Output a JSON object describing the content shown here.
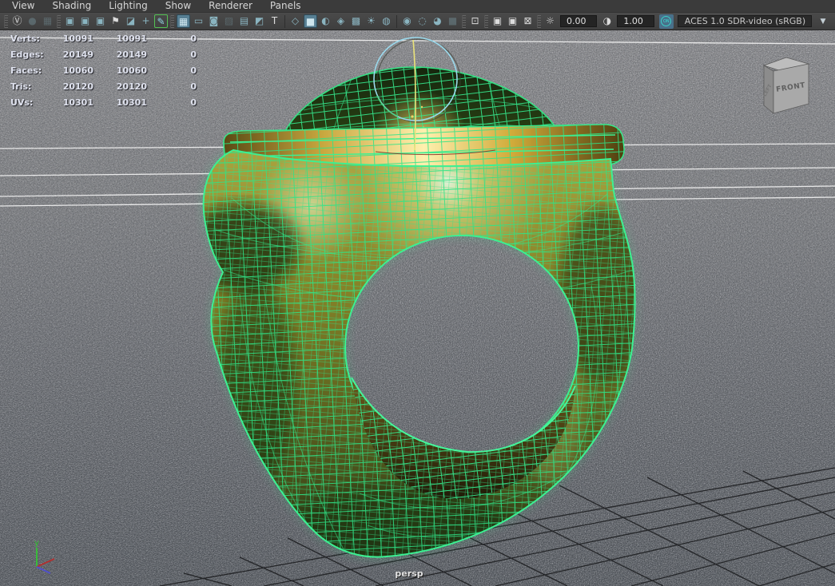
{
  "menu_bar": {
    "items": [
      "View",
      "Shading",
      "Lighting",
      "Show",
      "Renderer",
      "Panels"
    ]
  },
  "toolbar": {
    "exposure_value": "0.00",
    "gamma_value": "1.00",
    "on_badge": "ON",
    "view_transform": "ACES 1.0 SDR-video (sRGB)",
    "dropdown_arrow": "▼",
    "icons": [
      {
        "name": "viewcube-toggle",
        "glyph": "Ⓥ"
      },
      {
        "name": "disabled-tool-a",
        "glyph": "●"
      },
      {
        "name": "disabled-tool-b",
        "glyph": "▦"
      },
      {
        "name": "select-camera",
        "glyph": "▣"
      },
      {
        "name": "lock-camera",
        "glyph": "▣"
      },
      {
        "name": "camera-attributes",
        "glyph": "▣"
      },
      {
        "name": "bookmark",
        "glyph": "⚑"
      },
      {
        "name": "image-plane",
        "glyph": "◪"
      },
      {
        "name": "pan-zoom",
        "glyph": "+"
      },
      {
        "name": "grease-pencil",
        "glyph": "✎"
      },
      {
        "name": "grid",
        "glyph": "▦"
      },
      {
        "name": "film-gate",
        "glyph": "▭"
      },
      {
        "name": "resolution-gate",
        "glyph": "◙"
      },
      {
        "name": "gate-mask",
        "glyph": "▨"
      },
      {
        "name": "field-chart",
        "glyph": "▤"
      },
      {
        "name": "safe-title",
        "glyph": "◩"
      },
      {
        "name": "hud-toggle",
        "glyph": "T"
      },
      {
        "name": "wireframe-mode",
        "glyph": "◇"
      },
      {
        "name": "shaded-mode",
        "glyph": "■"
      },
      {
        "name": "wireframe-on-shaded",
        "glyph": "◐"
      },
      {
        "name": "textured-mode",
        "glyph": "◈"
      },
      {
        "name": "use-default-material",
        "glyph": "▩"
      },
      {
        "name": "lighting-mode",
        "glyph": "☀"
      },
      {
        "name": "shadows",
        "glyph": "◍"
      },
      {
        "name": "screen-space-ao",
        "glyph": "◉"
      },
      {
        "name": "motion-blur",
        "glyph": "◌"
      },
      {
        "name": "exposure-toggle",
        "glyph": "◕"
      },
      {
        "name": "depth-of-field",
        "glyph": "■"
      },
      {
        "name": "isolate-select",
        "glyph": "⊡"
      },
      {
        "name": "duplicate-a",
        "glyph": "▣"
      },
      {
        "name": "duplicate-b",
        "glyph": "▣"
      },
      {
        "name": "snapshot",
        "glyph": "⊠"
      },
      {
        "name": "exposure-control",
        "glyph": "☼"
      },
      {
        "name": "gamma-control",
        "glyph": "◑"
      }
    ]
  },
  "hud": {
    "rows": [
      {
        "label": "Verts:",
        "value1": "10091",
        "value2": "10091",
        "value3": "0"
      },
      {
        "label": "Edges:",
        "value1": "20149",
        "value2": "20149",
        "value3": "0"
      },
      {
        "label": "Faces:",
        "value1": "10060",
        "value2": "10060",
        "value3": "0"
      },
      {
        "label": "Tris:",
        "value1": "20120",
        "value2": "20120",
        "value3": "0"
      },
      {
        "label": "UVs:",
        "value1": "10301",
        "value2": "10301",
        "value3": "0"
      }
    ]
  },
  "viewport": {
    "camera_label": "persp",
    "view_cube": {
      "front_label": "FRONT",
      "left_label": "LEFT"
    },
    "axis_gizmo": {
      "y_label": "y"
    }
  },
  "colors": {
    "wireframe_green": "#2ee487",
    "gold": "#c9a43f",
    "toolbar_accent": "#8ab4c0",
    "active_icon_bg": "#577f93",
    "manipulator_blue": "#9ad9ec"
  }
}
